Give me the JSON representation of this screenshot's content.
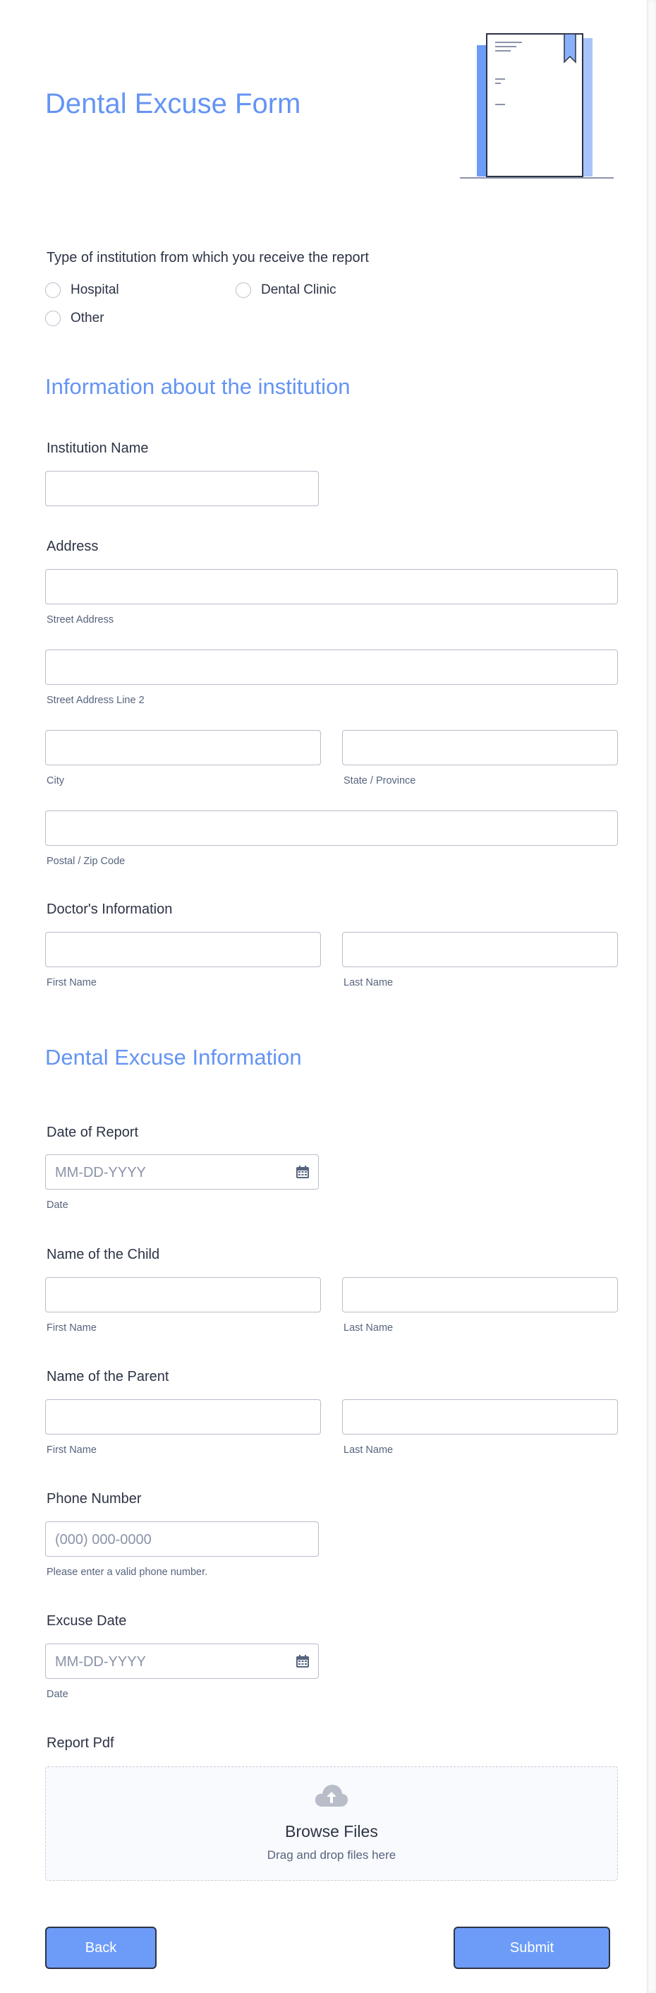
{
  "form": {
    "title": "Dental Excuse Form"
  },
  "institution_type": {
    "label": "Type of institution from which you receive the report",
    "options": [
      "Hospital",
      "Dental Clinic",
      "Other"
    ]
  },
  "section_institution": {
    "title": "Information about the institution"
  },
  "institution_name": {
    "label": "Institution Name"
  },
  "address": {
    "label": "Address",
    "street": "Street Address",
    "street2": "Street Address Line 2",
    "city": "City",
    "state": "State / Province",
    "zip": "Postal / Zip Code"
  },
  "doctor": {
    "label": "Doctor's Information",
    "first": "First Name",
    "last": "Last Name"
  },
  "section_excuse": {
    "title": "Dental Excuse Information"
  },
  "date_of_report": {
    "label": "Date of Report",
    "placeholder": "MM-DD-YYYY",
    "sublabel": "Date"
  },
  "child": {
    "label": "Name of the Child",
    "first": "First Name",
    "last": "Last Name"
  },
  "parent": {
    "label": "Name of the Parent",
    "first": "First Name",
    "last": "Last Name"
  },
  "phone": {
    "label": "Phone Number",
    "placeholder": "(000) 000-0000",
    "sublabel": "Please enter a valid phone number."
  },
  "excuse_date": {
    "label": "Excuse Date",
    "placeholder": "MM-DD-YYYY",
    "sublabel": "Date"
  },
  "report_pdf": {
    "label": "Report Pdf",
    "browse": "Browse Files",
    "drag": "Drag and drop files here"
  },
  "buttons": {
    "back": "Back",
    "submit": "Submit"
  },
  "colors": {
    "accent": "#6494f5",
    "button": "#6d9cf8",
    "text": "#2c3345",
    "sublabel": "#57647e",
    "border": "#b8bdc9"
  }
}
